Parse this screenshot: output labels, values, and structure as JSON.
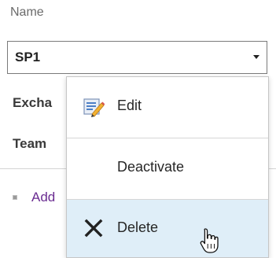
{
  "form": {
    "name_label": "Name",
    "name_value": "SP1",
    "exchange_label": "Excha",
    "team_label": "Team",
    "add_link": "Add"
  },
  "context_menu": {
    "items": [
      {
        "label": "Edit",
        "icon": "edit-icon"
      },
      {
        "label": "Deactivate",
        "icon": ""
      },
      {
        "label": "Delete",
        "icon": "delete-icon",
        "hovered": true
      }
    ]
  },
  "colors": {
    "link": "#6a2c91",
    "hover_bg": "#dfeef8",
    "label_muted": "#6b6b6b"
  }
}
